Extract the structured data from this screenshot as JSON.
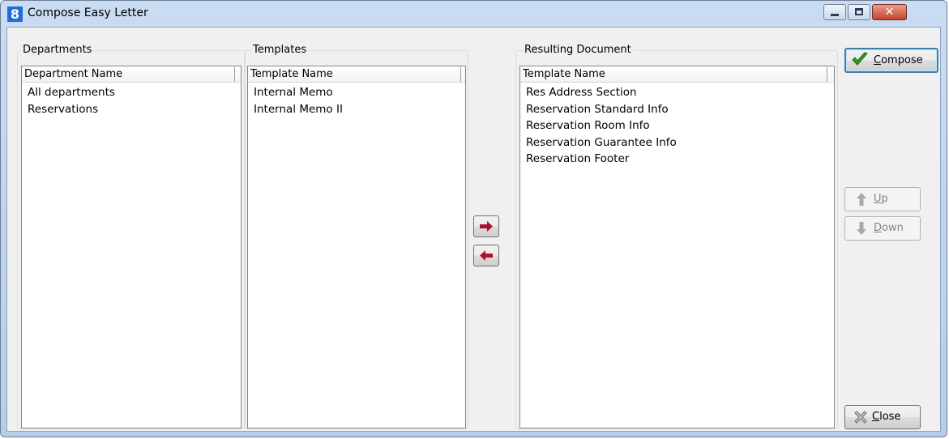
{
  "window": {
    "title": "Compose Easy Letter",
    "app_icon_text": "8",
    "close_glyph": "✕"
  },
  "departments": {
    "legend": "Departments",
    "column_header": "Department Name",
    "items": [
      "All departments",
      "Reservations"
    ]
  },
  "templates": {
    "legend": "Templates",
    "column_header": "Template Name",
    "items": [
      "Internal Memo",
      "Internal Memo II"
    ]
  },
  "transfer": {
    "add_icon": "arrow-right-icon",
    "remove_icon": "arrow-left-icon"
  },
  "resulting": {
    "legend": "Resulting Document",
    "column_header": "Template Name",
    "items": [
      "Res Address Section",
      "Reservation Standard Info",
      "Reservation Room Info",
      "Reservation Guarantee Info",
      "Reservation Footer"
    ]
  },
  "buttons": {
    "compose_prefix": "",
    "compose_mnemonic": "C",
    "compose_rest": "ompose",
    "up_mnemonic": "U",
    "up_rest": "p",
    "down_mnemonic": "D",
    "down_rest": "own",
    "close_mnemonic": "C",
    "close_rest": "lose"
  },
  "colors": {
    "arrow_red": "#b01030",
    "check_green": "#3a9a1e"
  }
}
